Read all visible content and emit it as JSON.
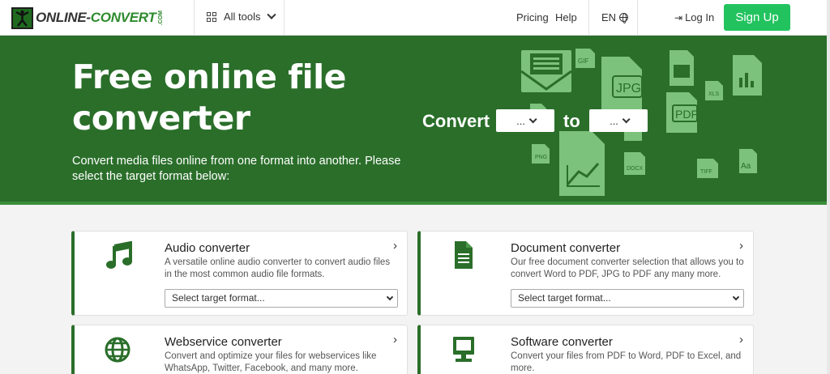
{
  "header": {
    "logo_text_a": "ONLINE-",
    "logo_text_b": "CONVERT",
    "logo_dotcom": ".COM",
    "all_tools": "All tools",
    "pricing": "Pricing",
    "help": "Help",
    "language": "EN",
    "login": "Log In",
    "signup": "Sign Up"
  },
  "hero": {
    "title": "Free online file converter",
    "subtitle": "Convert media files online from one format into another. Please select the target format below:",
    "convert_label": "Convert",
    "to_label": "to",
    "from_select": "...",
    "to_select": "...",
    "art_labels": [
      "GIF",
      "JPG",
      "XLS",
      "PDF",
      "PNG",
      "DOCX",
      "TIFF",
      "Aa"
    ]
  },
  "cards": [
    {
      "title": "Audio converter",
      "description": "A versatile online audio converter to convert audio files in the most common audio file formats.",
      "select": "Select target format...",
      "icon": "music-note-icon"
    },
    {
      "title": "Document converter",
      "description": "Our free document converter selection that allows you to convert Word to PDF, JPG to PDF any many more.",
      "select": "Select target format...",
      "icon": "document-icon"
    },
    {
      "title": "Webservice converter",
      "description": "Convert and optimize your files for webservices like WhatsApp, Twitter, Facebook, and many more.",
      "icon": "globe-icon"
    },
    {
      "title": "Software converter",
      "description": "Convert your files from PDF to Word, PDF to Excel, and more.",
      "icon": "monitor-icon"
    }
  ],
  "colors": {
    "brand_green": "#2a6e2a",
    "signup_green": "#22c35e",
    "art_green": "#7cc27c"
  }
}
